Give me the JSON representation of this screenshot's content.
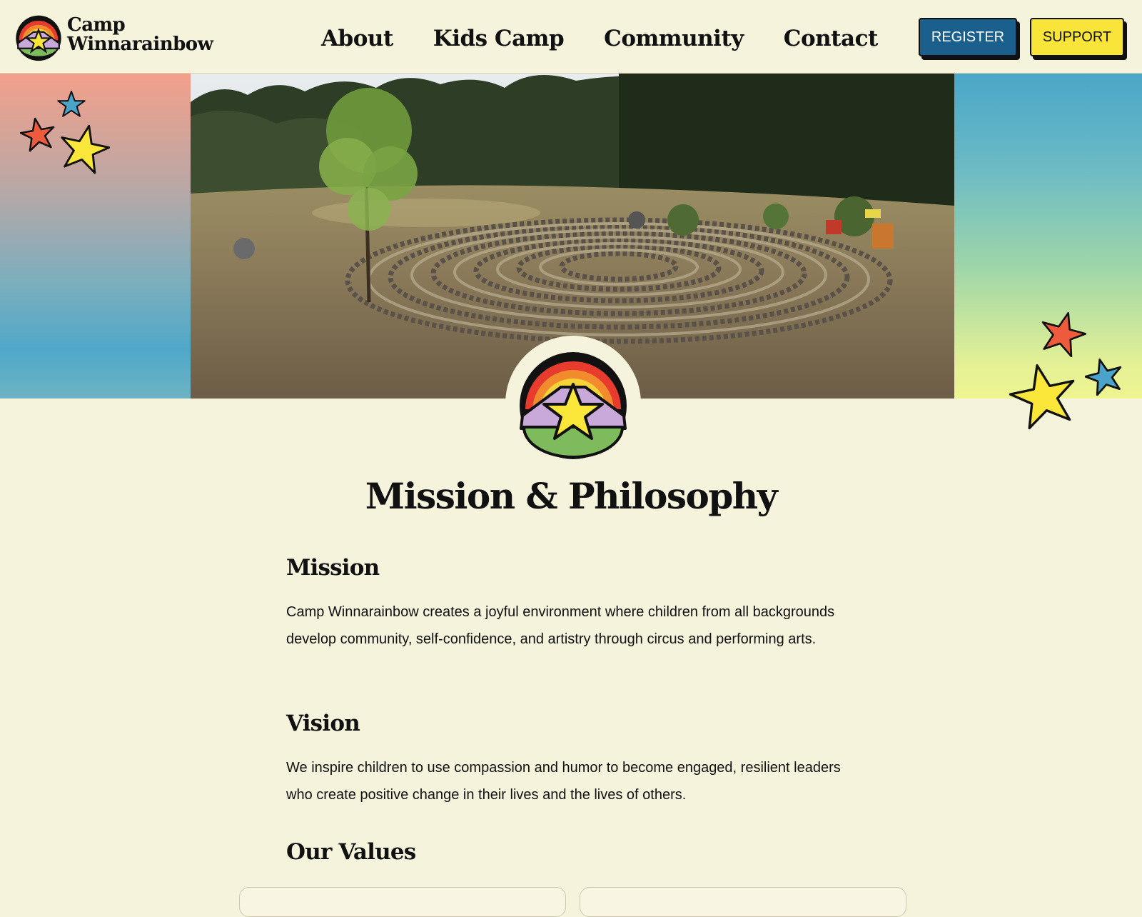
{
  "header": {
    "logo_line1": "Camp",
    "logo_line2": "Winnarainbow",
    "nav": [
      {
        "label": "About"
      },
      {
        "label": "Kids Camp"
      },
      {
        "label": "Community"
      },
      {
        "label": "Contact"
      }
    ],
    "register_label": "REGISTER",
    "support_label": "SUPPORT"
  },
  "colors": {
    "background": "#f6f3dc",
    "register_bg": "#1b5f8c",
    "support_bg": "#f9e43a",
    "star_red": "#ee5a3c",
    "star_blue": "#4aa3c9",
    "star_yellow": "#fbe63a"
  },
  "hero": {
    "image": "labyrinth-photo"
  },
  "main": {
    "title": "Mission & Philosophy",
    "mission_heading": "Mission",
    "mission_text": "Camp Winnarainbow creates a joyful environment where children from all backgrounds develop community, self-confidence, and artistry through circus and performing arts.",
    "vision_heading": "Vision",
    "vision_text": "We inspire children to use compassion and humor to become engaged, resilient leaders who create positive change in their lives and the lives of others.",
    "values_heading": "Our Values"
  }
}
